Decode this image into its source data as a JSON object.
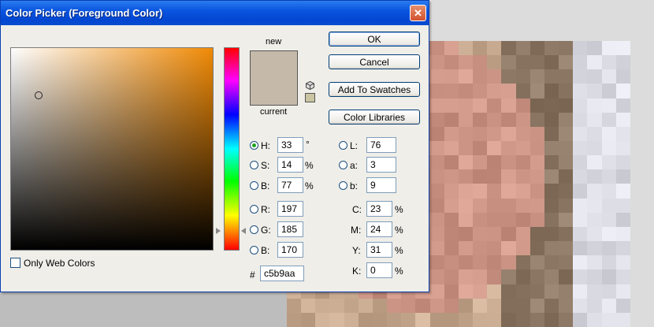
{
  "dialog": {
    "title": "Color Picker (Foreground Color)",
    "close_glyph": "✕",
    "new_label": "new",
    "current_label": "current",
    "new_color": "#c5b9aa",
    "current_color": "#c5b9aa",
    "only_web_colors_label": "Only Web Colors",
    "only_web_colors_checked": false
  },
  "buttons": {
    "ok": "OK",
    "cancel": "Cancel",
    "add_to_swatches": "Add To Swatches",
    "color_libraries": "Color Libraries"
  },
  "hsb": {
    "h": {
      "label": "H:",
      "value": "33",
      "unit": "°",
      "selected": true
    },
    "s": {
      "label": "S:",
      "value": "14",
      "unit": "%"
    },
    "b": {
      "label": "B:",
      "value": "77",
      "unit": "%"
    }
  },
  "rgb": {
    "r": {
      "label": "R:",
      "value": "197"
    },
    "g": {
      "label": "G:",
      "value": "185"
    },
    "b": {
      "label": "B:",
      "value": "170"
    }
  },
  "lab": {
    "l": {
      "label": "L:",
      "value": "76"
    },
    "a": {
      "label": "a:",
      "value": "3"
    },
    "b": {
      "label": "b:",
      "value": "9"
    }
  },
  "cmyk": {
    "c": {
      "label": "C:",
      "value": "23",
      "unit": "%"
    },
    "m": {
      "label": "M:",
      "value": "24",
      "unit": "%"
    },
    "y": {
      "label": "Y:",
      "value": "31",
      "unit": "%"
    },
    "k": {
      "label": "K:",
      "value": "0",
      "unit": "%"
    }
  },
  "hex": {
    "label": "#",
    "value": "c5b9aa"
  },
  "colors": {
    "field_hue": "#f08a06",
    "titlebar": "#0a55df"
  }
}
